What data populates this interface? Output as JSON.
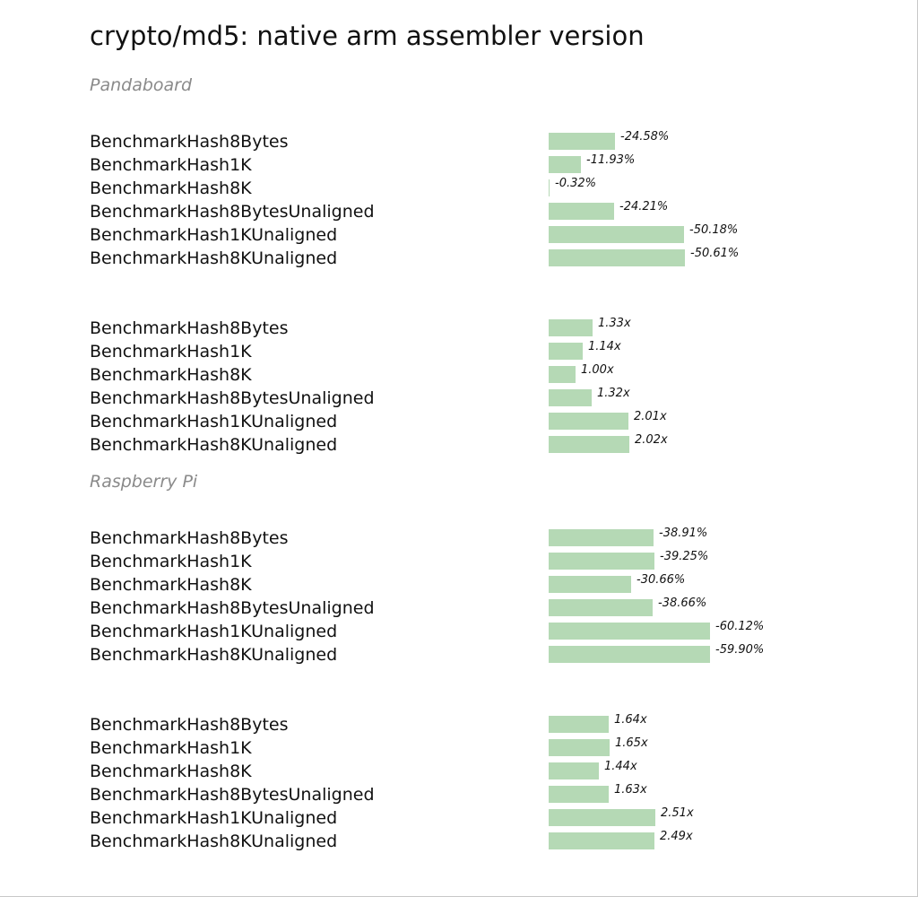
{
  "title": "crypto/md5: native arm assembler version",
  "chart_data": [
    {
      "type": "bar",
      "section": "Pandaboard",
      "categories": [
        "BenchmarkHash8Bytes",
        "BenchmarkHash1K",
        "BenchmarkHash8K",
        "BenchmarkHash8BytesUnaligned",
        "BenchmarkHash1KUnaligned",
        "BenchmarkHash8KUnaligned"
      ],
      "values": [
        -24.58,
        -11.93,
        -0.32,
        -24.21,
        -50.18,
        -50.61
      ],
      "labels": [
        "-24.58%",
        "-11.93%",
        "-0.32%",
        "-24.21%",
        "-50.18%",
        "-50.61%"
      ],
      "unit": "%"
    },
    {
      "type": "bar",
      "section": "",
      "categories": [
        "BenchmarkHash8Bytes",
        "BenchmarkHash1K",
        "BenchmarkHash8K",
        "BenchmarkHash8BytesUnaligned",
        "BenchmarkHash1KUnaligned",
        "BenchmarkHash8KUnaligned"
      ],
      "values": [
        1.33,
        1.14,
        1.0,
        1.32,
        2.01,
        2.02
      ],
      "labels": [
        "1.33x",
        "1.14x",
        "1.00x",
        "1.32x",
        "2.01x",
        "2.02x"
      ],
      "unit": "x"
    },
    {
      "type": "bar",
      "section": "Raspberry Pi",
      "categories": [
        "BenchmarkHash8Bytes",
        "BenchmarkHash1K",
        "BenchmarkHash8K",
        "BenchmarkHash8BytesUnaligned",
        "BenchmarkHash1KUnaligned",
        "BenchmarkHash8KUnaligned"
      ],
      "values": [
        -38.91,
        -39.25,
        -30.66,
        -38.66,
        -60.12,
        -59.9
      ],
      "labels": [
        "-38.91%",
        "-39.25%",
        "-30.66%",
        "-38.66%",
        "-60.12%",
        "-59.90%"
      ],
      "unit": "%"
    },
    {
      "type": "bar",
      "section": "",
      "categories": [
        "BenchmarkHash8Bytes",
        "BenchmarkHash1K",
        "BenchmarkHash8K",
        "BenchmarkHash8BytesUnaligned",
        "BenchmarkHash1KUnaligned",
        "BenchmarkHash8KUnaligned"
      ],
      "values": [
        1.64,
        1.65,
        1.44,
        1.63,
        2.51,
        2.49
      ],
      "labels": [
        "1.64x",
        "1.65x",
        "1.44x",
        "1.63x",
        "2.51x",
        "2.49x"
      ],
      "unit": "x"
    }
  ],
  "colors": {
    "bar": "#b5d9b5",
    "heading": "#8a8a8a",
    "text": "#111111"
  }
}
